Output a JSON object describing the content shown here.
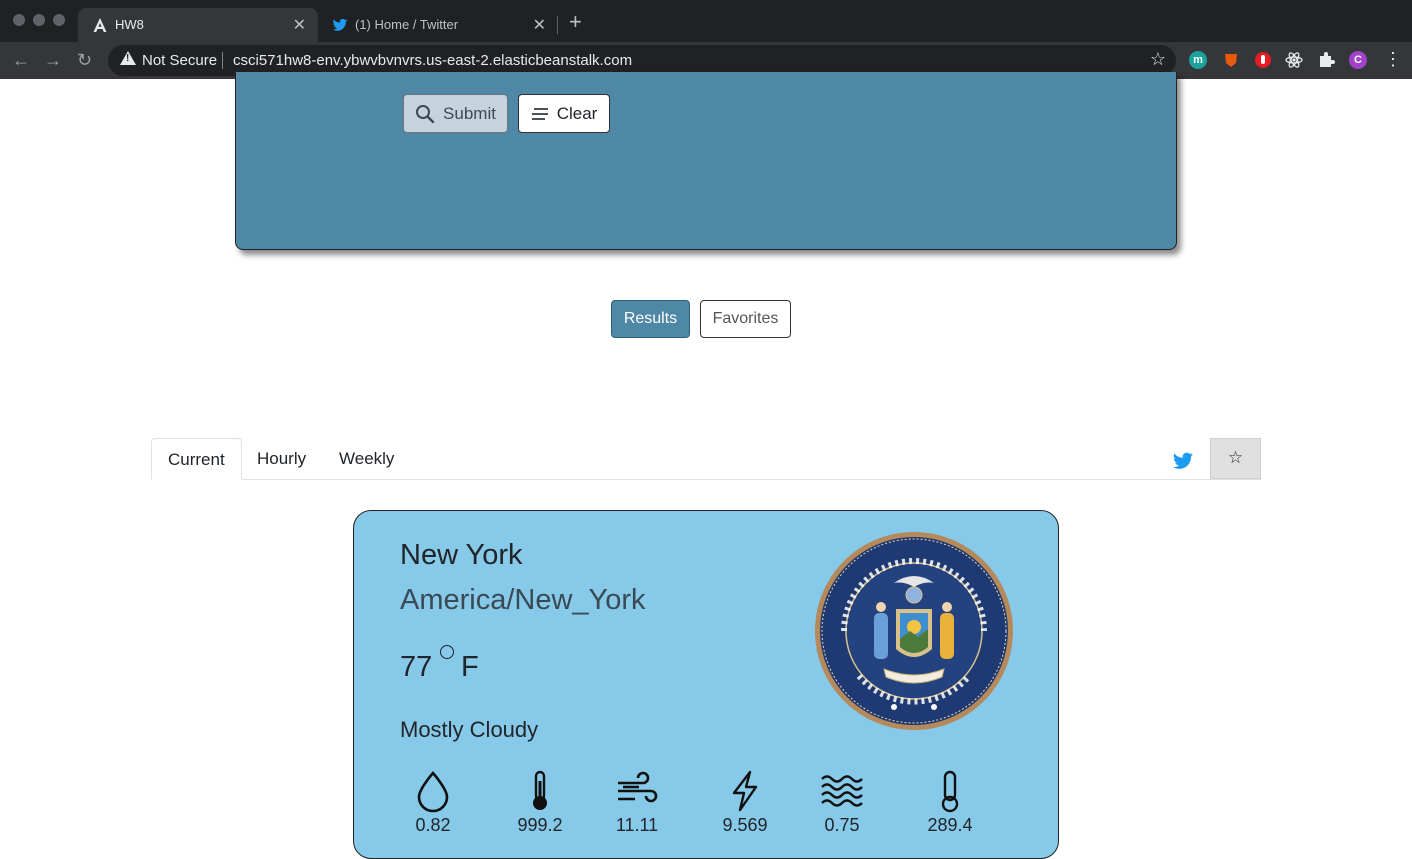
{
  "browser": {
    "tabs": [
      {
        "title": "HW8",
        "active": true,
        "favicon": "angular-icon"
      },
      {
        "title": "(1) Home / Twitter",
        "active": false,
        "favicon": "twitter-icon"
      }
    ],
    "security_label": "Not Secure",
    "url": "csci571hw8-env.ybwvbvnvrs.us-east-2.elasticbeanstalk.com",
    "profile_initial": "C",
    "extension_initial": "m"
  },
  "search": {
    "submit_label": "Submit",
    "clear_label": "Clear"
  },
  "toggle": {
    "results_label": "Results",
    "favorites_label": "Favorites"
  },
  "detail_tabs": {
    "current_label": "Current",
    "hourly_label": "Hourly",
    "weekly_label": "Weekly"
  },
  "weather": {
    "city": "New York",
    "timezone": "America/New_York",
    "temperature": "77",
    "unit": "F",
    "summary": "Mostly Cloudy",
    "seal_text": "THE GREAT SEAL OF THE STATE OF NEW YORK",
    "seal_motto": "EXCELSIOR",
    "metrics": [
      {
        "icon": "humidity-icon",
        "value": "0.82"
      },
      {
        "icon": "pressure-icon",
        "value": "999.2"
      },
      {
        "icon": "wind-speed-icon",
        "value": "11.11"
      },
      {
        "icon": "visibility-icon",
        "value": "9.569"
      },
      {
        "icon": "cloud-cover-icon",
        "value": "0.75"
      },
      {
        "icon": "ozone-icon",
        "value": "289.4"
      }
    ]
  },
  "colors": {
    "panel": "#4f87a6",
    "card": "#87c9e8"
  }
}
